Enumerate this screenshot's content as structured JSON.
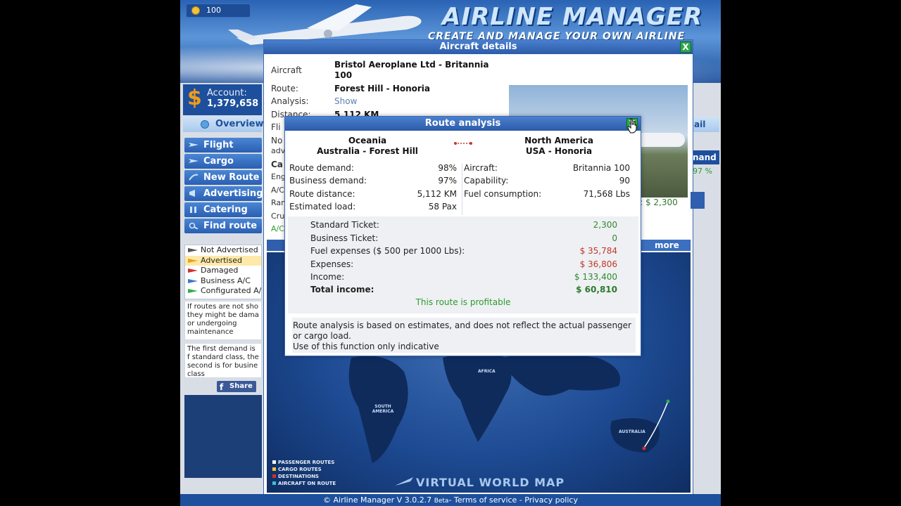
{
  "header": {
    "coins": "100",
    "logo_title": "AIRLINE MANAGER",
    "logo_subtitle": "CREATE AND MANAGE YOUR OWN AIRLINE"
  },
  "account": {
    "label": "Account:",
    "value": "1,379,658"
  },
  "overview_tab": "Overview",
  "menu": [
    {
      "label": "Flight"
    },
    {
      "label": "Cargo"
    },
    {
      "label": "New Route"
    },
    {
      "label": "Advertising"
    },
    {
      "label": "Catering"
    },
    {
      "label": "Find route"
    }
  ],
  "legend": [
    {
      "label": "Not Advertised",
      "color": "#555555"
    },
    {
      "label": "Advertised",
      "color": "#e8a21a"
    },
    {
      "label": "Damaged",
      "color": "#d03030"
    },
    {
      "label": "Business A/C",
      "color": "#3a7ad0"
    },
    {
      "label": "Configurated A/",
      "color": "#2fb04a"
    }
  ],
  "notes": {
    "note1": "If routes are not sho they might be dama or undergoing maintenance",
    "note2": "The first demand is f standard class, the second is for busine class"
  },
  "share_label": "Share",
  "right_edge": {
    "mail": "ail",
    "demand": "nand",
    "demand_pct": "97 %"
  },
  "details": {
    "title": "Aircraft details",
    "close": "X",
    "aircraft_label": "Aircraft",
    "aircraft_value_1": "Bristol Aeroplane Ltd - Britannia",
    "aircraft_value_2": "100",
    "route_label": "Route:",
    "route_value": "Forest Hill - Honoria",
    "analysis_label": "Analysis:",
    "analysis_link": "Show",
    "distance_label": "Distance:",
    "distance_value": "5,112 KM",
    "flight_label": "Fli",
    "no_label": "No",
    "adv_label": "adv",
    "ca_label": "Ca",
    "en_label": "Eng",
    "ac_label": "A/C",
    "ra_label": "Ran",
    "cr_label": "Cru",
    "ac2_label": "A/C",
    "ticket": "et: $ 2,300",
    "more": "more",
    "map_label": "VIRTUAL WORLD MAP",
    "map_legend": [
      {
        "label": "PASSENGER ROUTES",
        "color": "#ffffff"
      },
      {
        "label": "CARGO ROUTES",
        "color": "#f2c23a"
      },
      {
        "label": "DESTINATIONS",
        "color": "#d03030"
      },
      {
        "label": "AIRCRAFT ON ROUTE",
        "color": "#3ac0d0"
      }
    ],
    "geo": {
      "africa": "AFRICA",
      "south_america": "SOUTH AMERICA",
      "australia": "AUSTRALIA"
    }
  },
  "route_analysis": {
    "title": "Route analysis",
    "close": "X",
    "from_region": "Oceania",
    "from_place": "Australia - Forest Hill",
    "to_region": "North America",
    "to_place": "USA - Honoria",
    "left_stats": [
      {
        "label": "Route demand:",
        "value": "98%"
      },
      {
        "label": "Business demand:",
        "value": "97%"
      },
      {
        "label": "Route distance:",
        "value": "5,112 KM"
      },
      {
        "label": "Estimated load:",
        "value": "58 Pax"
      }
    ],
    "right_stats": [
      {
        "label": "Aircraft:",
        "value": "Britannia 100"
      },
      {
        "label": "Capability:",
        "value": "90"
      },
      {
        "label": "Fuel consumption:",
        "value": "71,568 Lbs"
      }
    ],
    "money": [
      {
        "label": "Standard Ticket:",
        "value": "2,300"
      },
      {
        "label": "Business Ticket:",
        "value": "0"
      },
      {
        "label": "Fuel expenses ($ 500 per 1000 Lbs):",
        "value": "$ 35,784"
      },
      {
        "label": "Expenses:",
        "value": "$ 36,806"
      },
      {
        "label": "Income:",
        "value": "$ 133,400"
      },
      {
        "label": "Total income:",
        "value": "$ 60,810"
      }
    ],
    "profit_text": "This route is profitable",
    "disclaimer_1": "Route analysis is based on estimates, and does not reflect the actual passenger or cargo load.",
    "disclaimer_2": "Use of this function only indicative"
  },
  "footer": {
    "prefix": "© Airline Manager V 3.0.2.7 ",
    "beta": "Beta",
    "suffix": "- Terms of service - Privacy policy"
  },
  "colors": {
    "brand_blue": "#1d4f9c",
    "profit_green": "#2f8a2f",
    "expense_red": "#c0392b",
    "close_green": "#2fa84a"
  }
}
